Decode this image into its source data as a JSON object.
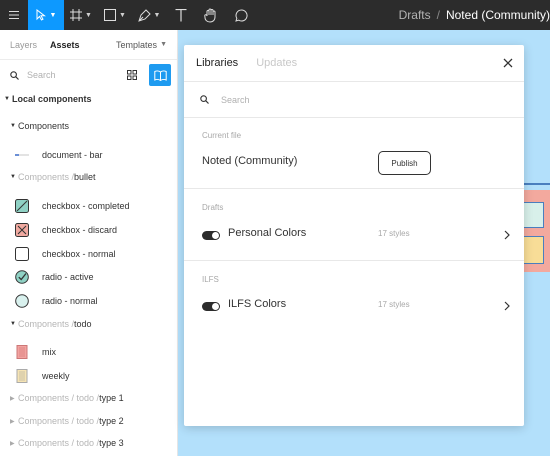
{
  "toolbar": {
    "drafts": "Drafts",
    "separator": "/",
    "file_name": "Noted (Community)"
  },
  "left_panel": {
    "tabs": [
      "Layers",
      "Assets"
    ],
    "templates_label": "Templates",
    "search_placeholder": "Search",
    "local_components": "Local components",
    "tree": [
      {
        "kind": "group",
        "prefix": "",
        "name": "Components"
      },
      {
        "kind": "item",
        "name": "document - bar",
        "icon": "document-bar-icon"
      },
      {
        "kind": "group",
        "prefix": "Components / ",
        "name": "bullet"
      },
      {
        "kind": "item",
        "name": "checkbox - completed",
        "icon": "checkbox-completed-icon"
      },
      {
        "kind": "item",
        "name": "checkbox - discard",
        "icon": "checkbox-discard-icon"
      },
      {
        "kind": "item",
        "name": "checkbox - normal",
        "icon": "checkbox-normal-icon"
      },
      {
        "kind": "item",
        "name": "radio - active",
        "icon": "radio-active-icon"
      },
      {
        "kind": "item",
        "name": "radio - normal",
        "icon": "radio-normal-icon"
      },
      {
        "kind": "group",
        "prefix": "Components / ",
        "name": "todo"
      },
      {
        "kind": "item",
        "name": "mix",
        "icon": "mix-thumb-icon"
      },
      {
        "kind": "item",
        "name": "weekly",
        "icon": "weekly-thumb-icon"
      },
      {
        "kind": "collapsed",
        "prefix": "Components / todo / ",
        "name": "type 1"
      },
      {
        "kind": "collapsed",
        "prefix": "Components / todo / ",
        "name": "type 2"
      },
      {
        "kind": "collapsed",
        "prefix": "Components / todo / ",
        "name": "type 3"
      }
    ]
  },
  "dialog": {
    "tabs": [
      "Libraries",
      "Updates"
    ],
    "search_placeholder": "Search",
    "current_file": {
      "label": "Current file",
      "name": "Noted (Community)",
      "publish": "Publish"
    },
    "drafts": {
      "label": "Drafts",
      "name": "Personal Colors",
      "styles": "17 styles",
      "enabled": true
    },
    "ilfs": {
      "label": "ILFS",
      "name": "ILFS Colors",
      "styles": "17 styles",
      "enabled": true
    }
  },
  "colors": {
    "toolbar": "#2c2c2c",
    "accent": "#0d99ff",
    "canvas": "#b3e0fb"
  }
}
